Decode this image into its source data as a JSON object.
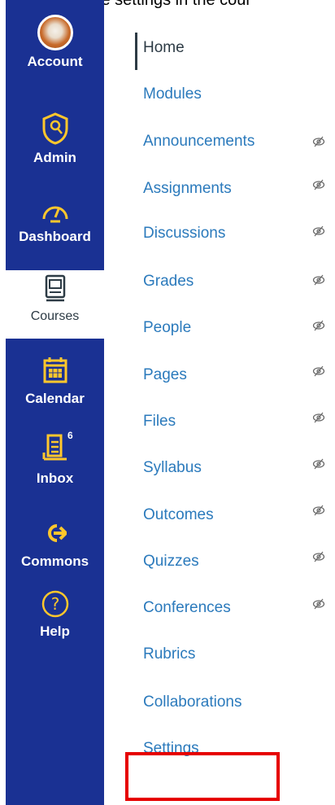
{
  "caption": "Go the course settings in the cour",
  "global_nav": {
    "account": "Account",
    "admin": "Admin",
    "dashboard": "Dashboard",
    "courses": "Courses",
    "calendar": "Calendar",
    "inbox": "Inbox",
    "inbox_badge": "6",
    "commons": "Commons",
    "help": "Help"
  },
  "course_nav": {
    "home": "Home",
    "modules": "Modules",
    "announcements": "Announcements",
    "assignments": "Assignments",
    "discussions": "Discussions",
    "grades": "Grades",
    "people": "People",
    "pages": "Pages",
    "files": "Files",
    "syllabus": "Syllabus",
    "outcomes": "Outcomes",
    "quizzes": "Quizzes",
    "conferences": "Conferences",
    "rubrics": "Rubrics",
    "collaborations": "Collaborations",
    "settings": "Settings"
  },
  "colors": {
    "sidebar": "#1a3193",
    "link": "#2b7abc",
    "highlight": "#e60000",
    "accent_yellow": "#ffc72c"
  }
}
